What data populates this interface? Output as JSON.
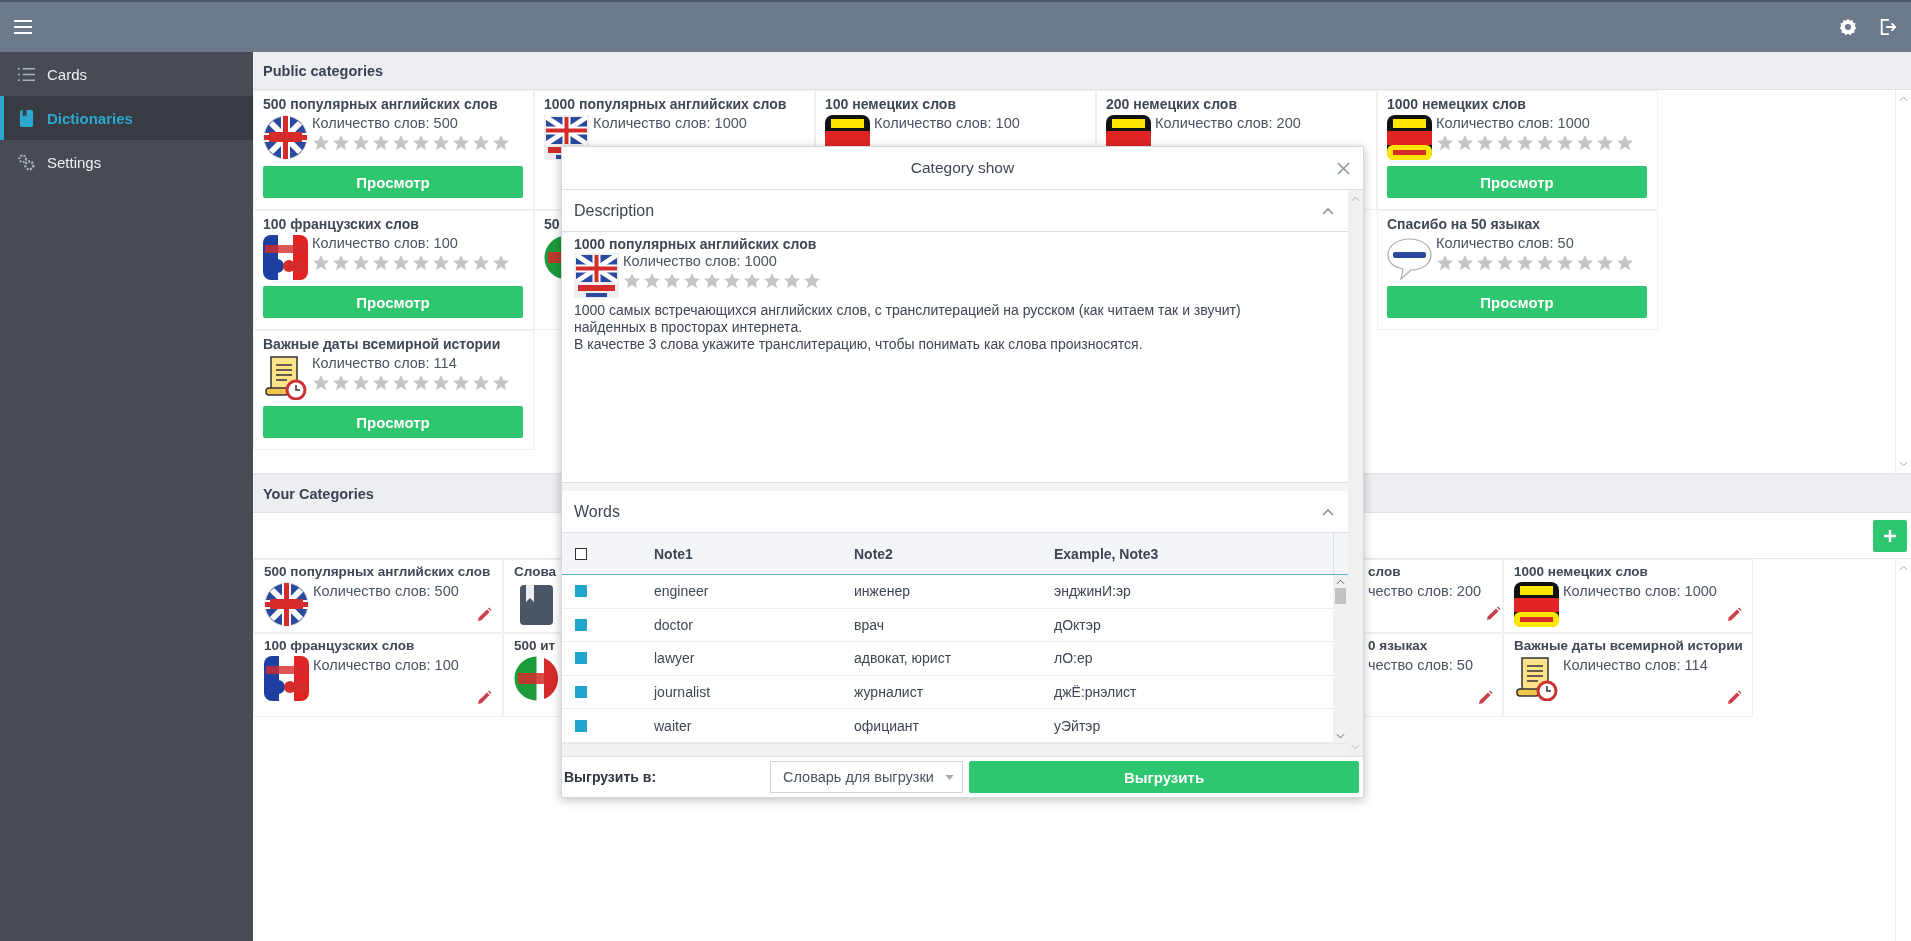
{
  "sidebar": {
    "items": [
      {
        "label": "Cards",
        "kind": "list",
        "selected": false
      },
      {
        "label": "Dictionaries",
        "kind": "book",
        "selected": true
      },
      {
        "label": "Settings",
        "kind": "gears",
        "selected": false
      }
    ]
  },
  "public_categories": {
    "title": "Public categories",
    "rows": [
      [
        {
          "title": "500 популярных английских слов",
          "image": {
            "kind": "uk_round"
          },
          "count": "Количество слов: 500",
          "stars": 0,
          "button": "Просмотр"
        },
        {
          "title": "1000 популярных английских слов",
          "image": {
            "kind": "uk_square"
          },
          "count": "Количество слов: 1000"
        },
        {
          "title": "100 немецких слов",
          "image": {
            "kind": "de"
          },
          "count": "Количество слов: 100"
        },
        {
          "title": "200 немецких слов",
          "image": {
            "kind": "de"
          },
          "count": "Количество слов: 200"
        },
        {
          "title": "1000 немецких слов",
          "image": {
            "kind": "de_top"
          },
          "count": "Количество слов: 1000",
          "stars": 0,
          "button": "Просмотр"
        }
      ],
      [
        {
          "title": "100 французских слов",
          "image": {
            "kind": "fr"
          },
          "count": "Количество слов: 100",
          "stars": 0,
          "button": "Просмотр"
        },
        {
          "title": "50",
          "image": {
            "kind": "it"
          }
        },
        null,
        null,
        {
          "title": "Спасибо на 50 языках",
          "image": {
            "kind": "thanks"
          },
          "count": "Количество слов: 50",
          "stars": 0,
          "button": "Просмотр"
        }
      ],
      [
        {
          "title": "Важные даты всемирной истории",
          "image": {
            "kind": "scroll"
          },
          "count": "Количество слов: 114",
          "stars": 0,
          "button": "Просмотр"
        }
      ]
    ]
  },
  "your_categories": {
    "title": "Your Categories",
    "rows": [
      [
        {
          "kind": "card",
          "title": "500 популярных английских слов",
          "image": {
            "kind": "uk_round"
          },
          "count": "Количество слов: 500"
        },
        {
          "kind": "cut_right",
          "title": "Слова",
          "image": {
            "kind": "book"
          }
        },
        null,
        null,
        {
          "kind": "cut",
          "title": "слов",
          "count": "чество слов: 200"
        },
        {
          "kind": "card",
          "title": "1000 немецких слов",
          "image": {
            "kind": "de_top"
          },
          "count": "Количество слов: 1000"
        }
      ],
      [
        {
          "kind": "card",
          "title": "100 французских слов",
          "image": {
            "kind": "fr"
          },
          "count": "Количество слов: 100"
        },
        {
          "kind": "cut_right",
          "title": "500 ит",
          "image": {
            "kind": "it"
          }
        },
        null,
        null,
        {
          "kind": "cut",
          "title": "0 языках",
          "count": "чество слов: 50"
        },
        {
          "kind": "card",
          "title": "Важные даты всемирной истории",
          "image": {
            "kind": "scroll"
          },
          "count": "Количество слов: 114"
        }
      ]
    ]
  },
  "modal": {
    "title": "Category show",
    "description": {
      "header": "Description",
      "expanded": true,
      "title": "1000 популярных английских слов",
      "image": {
        "kind": "uk_square"
      },
      "count": "Количество слов: 1000",
      "stars": 0,
      "paragraphs": [
        "1000 самых встречающихся английских слов, с транслитерацией на русском (как читаем так и звучит) найденных в просторах интернета.",
        "В качестве 3 слова укажите транслитерацию, чтобы понимать как слова произносятся."
      ]
    },
    "words": {
      "header": "Words",
      "expanded": true,
      "all_checked": false,
      "columns": [
        "Note1",
        "Note2",
        "Example, Note3"
      ],
      "rows": [
        {
          "checked": true,
          "cells": [
            "engineer",
            "инженер",
            "энджинИ:эр"
          ]
        },
        {
          "checked": true,
          "cells": [
            "doctor",
            "врач",
            "дОктэр"
          ]
        },
        {
          "checked": true,
          "cells": [
            "lawyer",
            "адвокат, юрист",
            "лО:ер"
          ]
        },
        {
          "checked": true,
          "cells": [
            "journalist",
            "журналист",
            "джЁ:рнэлист"
          ]
        },
        {
          "checked": true,
          "cells": [
            "waiter",
            "официант",
            "уЭйтэр"
          ]
        }
      ]
    },
    "footer": {
      "label": "Выгрузить в:",
      "select": {
        "placeholder": "Словарь для выгрузки"
      },
      "button": "Выгрузить"
    }
  }
}
